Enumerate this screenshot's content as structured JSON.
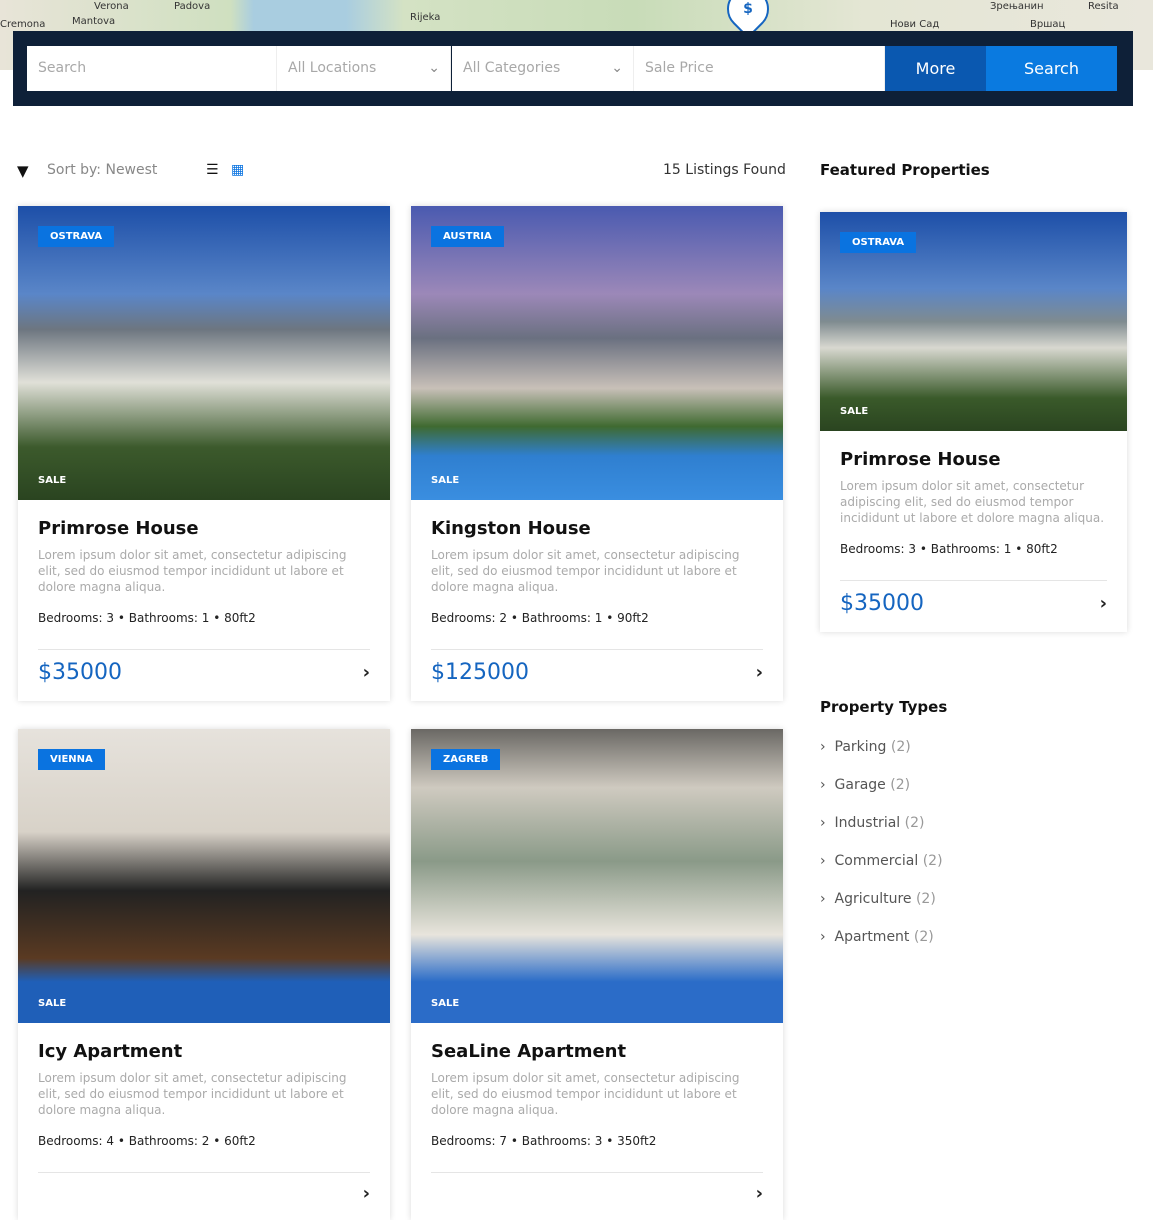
{
  "map": {
    "labels": [
      "Verona",
      "Padova",
      "Cremona",
      "Mantova",
      "Rijeka",
      "Нови Сад",
      "Зрењанин",
      "Resita",
      "Вршац"
    ],
    "pin_icon": "$"
  },
  "search": {
    "search_placeholder": "Search",
    "locations": "All Locations",
    "categories": "All Categories",
    "price_placeholder": "Sale Price",
    "more_label": "More",
    "search_label": "Search"
  },
  "toolbar": {
    "sort": "Sort by: Newest",
    "count": "15 Listings Found"
  },
  "colors": {
    "accent": "#0a73e0",
    "bar": "#0e2038",
    "price": "#1565c0"
  },
  "listings": [
    {
      "location": "OSTRAVA",
      "status": "SALE",
      "title": "Primrose House",
      "desc": "Lorem ipsum dolor sit amet, consectetur adipiscing elit, sed do eiusmod tempor incididunt ut labore et dolore magna aliqua.",
      "meta": "Bedrooms: 3 •  Bathrooms: 1 •  80ft2",
      "price": "$35000"
    },
    {
      "location": "AUSTRIA",
      "status": "SALE",
      "title": "Kingston House",
      "desc": "Lorem ipsum dolor sit amet, consectetur adipiscing elit, sed do eiusmod tempor incididunt ut labore et dolore magna aliqua.",
      "meta": "Bedrooms: 2 •  Bathrooms: 1 •  90ft2",
      "price": "$125000"
    },
    {
      "location": "VIENNA",
      "status": "SALE",
      "title": "Icy Apartment",
      "desc": "Lorem ipsum dolor sit amet, consectetur adipiscing elit, sed do eiusmod tempor incididunt ut labore et dolore magna aliqua.",
      "meta": "Bedrooms: 4 •  Bathrooms: 2 •  60ft2",
      "price": ""
    },
    {
      "location": "ZAGREB",
      "status": "SALE",
      "title": "SeaLine Apartment",
      "desc": "Lorem ipsum dolor sit amet, consectetur adipiscing elit, sed do eiusmod tempor incididunt ut labore et dolore magna aliqua.",
      "meta": "Bedrooms: 7 •  Bathrooms: 3 •  350ft2",
      "price": ""
    }
  ],
  "featured": {
    "heading": "Featured Properties",
    "location": "OSTRAVA",
    "status": "SALE",
    "title": "Primrose House",
    "desc": "Lorem ipsum dolor sit amet, consectetur adipiscing elit, sed do eiusmod tempor incididunt ut labore et dolore magna aliqua.",
    "meta": "Bedrooms: 3 •  Bathrooms: 1 •  80ft2",
    "price": "$35000"
  },
  "property_types": {
    "heading": "Property Types",
    "items": [
      {
        "label": "Parking",
        "count": "(2)"
      },
      {
        "label": "Garage",
        "count": "(2)"
      },
      {
        "label": "Industrial",
        "count": "(2)"
      },
      {
        "label": "Commercial",
        "count": "(2)"
      },
      {
        "label": "Agriculture",
        "count": "(2)"
      },
      {
        "label": "Apartment",
        "count": "(2)"
      }
    ]
  }
}
